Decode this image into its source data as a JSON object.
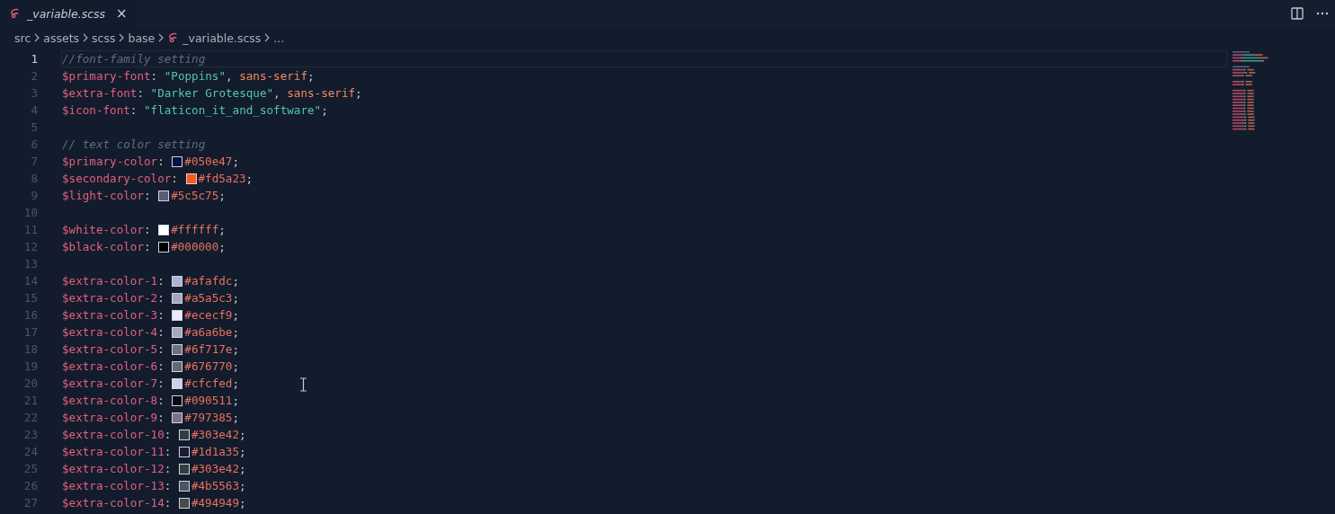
{
  "tab": {
    "label": "_variable.scss",
    "close": "×",
    "selected": true
  },
  "breadcrumb": [
    "src",
    "assets",
    "scss",
    "base",
    "_variable.scss",
    "..."
  ],
  "lines": [
    {
      "number": "1",
      "current": true,
      "tokens": [
        {
          "kind": "comment",
          "text": "//font-family setting"
        }
      ]
    },
    {
      "number": "2",
      "current": false,
      "tokens": [
        {
          "kind": "variable",
          "text": "$primary-font"
        },
        {
          "kind": "punct",
          "text": ": "
        },
        {
          "kind": "string",
          "text": "\"Poppins\""
        },
        {
          "kind": "punct",
          "text": ", "
        },
        {
          "kind": "value",
          "text": "sans-serif"
        },
        {
          "kind": "punct",
          "text": ";"
        }
      ]
    },
    {
      "number": "3",
      "current": false,
      "tokens": [
        {
          "kind": "variable",
          "text": "$extra-font"
        },
        {
          "kind": "punct",
          "text": ": "
        },
        {
          "kind": "string",
          "text": "\"Darker Grotesque\""
        },
        {
          "kind": "punct",
          "text": ", "
        },
        {
          "kind": "value",
          "text": "sans-serif"
        },
        {
          "kind": "punct",
          "text": ";"
        }
      ]
    },
    {
      "number": "4",
      "current": false,
      "tokens": [
        {
          "kind": "variable",
          "text": "$icon-font"
        },
        {
          "kind": "punct",
          "text": ": "
        },
        {
          "kind": "string",
          "text": "\"flaticon_it_and_software\""
        },
        {
          "kind": "punct",
          "text": ";"
        }
      ]
    },
    {
      "number": "5",
      "current": false
    },
    {
      "number": "6",
      "current": false,
      "tokens": [
        {
          "kind": "comment",
          "text": "// text color setting"
        }
      ]
    },
    {
      "number": "7",
      "current": false,
      "tokens": [
        {
          "kind": "variable",
          "text": "$primary-color"
        },
        {
          "kind": "punct",
          "text": ": "
        },
        {
          "kind": "swatch",
          "color": "#050e47"
        },
        {
          "kind": "value",
          "text": "#050e47"
        },
        {
          "kind": "punct",
          "text": ";"
        }
      ]
    },
    {
      "number": "8",
      "current": false,
      "tokens": [
        {
          "kind": "variable",
          "text": "$secondary-color"
        },
        {
          "kind": "punct",
          "text": ": "
        },
        {
          "kind": "swatch",
          "color": "#fd5a23"
        },
        {
          "kind": "value",
          "text": "#fd5a23"
        },
        {
          "kind": "punct",
          "text": ";"
        }
      ]
    },
    {
      "number": "9",
      "current": false,
      "tokens": [
        {
          "kind": "variable",
          "text": "$light-color"
        },
        {
          "kind": "punct",
          "text": ": "
        },
        {
          "kind": "swatch",
          "color": "#5c5c75"
        },
        {
          "kind": "value",
          "text": "#5c5c75"
        },
        {
          "kind": "punct",
          "text": ";"
        }
      ]
    },
    {
      "number": "10",
      "current": false
    },
    {
      "number": "11",
      "current": false,
      "tokens": [
        {
          "kind": "variable",
          "text": "$white-color"
        },
        {
          "kind": "punct",
          "text": ": "
        },
        {
          "kind": "swatch",
          "color": "#ffffff"
        },
        {
          "kind": "value",
          "text": "#ffffff"
        },
        {
          "kind": "punct",
          "text": ";"
        }
      ]
    },
    {
      "number": "12",
      "current": false,
      "tokens": [
        {
          "kind": "variable",
          "text": "$black-color"
        },
        {
          "kind": "punct",
          "text": ": "
        },
        {
          "kind": "swatch",
          "color": "#000000"
        },
        {
          "kind": "value",
          "text": "#000000"
        },
        {
          "kind": "punct",
          "text": ";"
        }
      ]
    },
    {
      "number": "13",
      "current": false
    },
    {
      "number": "14",
      "current": false,
      "tokens": [
        {
          "kind": "variable",
          "text": "$extra-color-1"
        },
        {
          "kind": "punct",
          "text": ": "
        },
        {
          "kind": "swatch",
          "color": "#afafdc"
        },
        {
          "kind": "value",
          "text": "#afafdc"
        },
        {
          "kind": "punct",
          "text": ";"
        }
      ]
    },
    {
      "number": "15",
      "current": false,
      "tokens": [
        {
          "kind": "variable",
          "text": "$extra-color-2"
        },
        {
          "kind": "punct",
          "text": ": "
        },
        {
          "kind": "swatch",
          "color": "#a5a5c3"
        },
        {
          "kind": "value",
          "text": "#a5a5c3"
        },
        {
          "kind": "punct",
          "text": ";"
        }
      ]
    },
    {
      "number": "16",
      "current": false,
      "tokens": [
        {
          "kind": "variable",
          "text": "$extra-color-3"
        },
        {
          "kind": "punct",
          "text": ": "
        },
        {
          "kind": "swatch",
          "color": "#ececf9"
        },
        {
          "kind": "value",
          "text": "#ececf9"
        },
        {
          "kind": "punct",
          "text": ";"
        }
      ]
    },
    {
      "number": "17",
      "current": false,
      "tokens": [
        {
          "kind": "variable",
          "text": "$extra-color-4"
        },
        {
          "kind": "punct",
          "text": ": "
        },
        {
          "kind": "swatch",
          "color": "#a6a6be"
        },
        {
          "kind": "value",
          "text": "#a6a6be"
        },
        {
          "kind": "punct",
          "text": ";"
        }
      ]
    },
    {
      "number": "18",
      "current": false,
      "tokens": [
        {
          "kind": "variable",
          "text": "$extra-color-5"
        },
        {
          "kind": "punct",
          "text": ": "
        },
        {
          "kind": "swatch",
          "color": "#6f717e"
        },
        {
          "kind": "value",
          "text": "#6f717e"
        },
        {
          "kind": "punct",
          "text": ";"
        }
      ]
    },
    {
      "number": "19",
      "current": false,
      "tokens": [
        {
          "kind": "variable",
          "text": "$extra-color-6"
        },
        {
          "kind": "punct",
          "text": ": "
        },
        {
          "kind": "swatch",
          "color": "#676770"
        },
        {
          "kind": "value",
          "text": "#676770"
        },
        {
          "kind": "punct",
          "text": ";"
        }
      ]
    },
    {
      "number": "20",
      "current": false,
      "tokens": [
        {
          "kind": "variable",
          "text": "$extra-color-7"
        },
        {
          "kind": "punct",
          "text": ": "
        },
        {
          "kind": "swatch",
          "color": "#cfcfed"
        },
        {
          "kind": "value",
          "text": "#cfcfed"
        },
        {
          "kind": "punct",
          "text": ";"
        }
      ]
    },
    {
      "number": "21",
      "current": false,
      "tokens": [
        {
          "kind": "variable",
          "text": "$extra-color-8"
        },
        {
          "kind": "punct",
          "text": ": "
        },
        {
          "kind": "swatch",
          "color": "#090511"
        },
        {
          "kind": "value",
          "text": "#090511"
        },
        {
          "kind": "punct",
          "text": ";"
        }
      ]
    },
    {
      "number": "22",
      "current": false,
      "tokens": [
        {
          "kind": "variable",
          "text": "$extra-color-9"
        },
        {
          "kind": "punct",
          "text": ": "
        },
        {
          "kind": "swatch",
          "color": "#797385"
        },
        {
          "kind": "value",
          "text": "#797385"
        },
        {
          "kind": "punct",
          "text": ";"
        }
      ]
    },
    {
      "number": "23",
      "current": false,
      "tokens": [
        {
          "kind": "variable",
          "text": "$extra-color-10"
        },
        {
          "kind": "punct",
          "text": ": "
        },
        {
          "kind": "swatch",
          "color": "#303e42"
        },
        {
          "kind": "value",
          "text": "#303e42"
        },
        {
          "kind": "punct",
          "text": ";"
        }
      ]
    },
    {
      "number": "24",
      "current": false,
      "tokens": [
        {
          "kind": "variable",
          "text": "$extra-color-11"
        },
        {
          "kind": "punct",
          "text": ": "
        },
        {
          "kind": "swatch",
          "color": "#1d1a35"
        },
        {
          "kind": "value",
          "text": "#1d1a35"
        },
        {
          "kind": "punct",
          "text": ";"
        }
      ]
    },
    {
      "number": "25",
      "current": false,
      "tokens": [
        {
          "kind": "variable",
          "text": "$extra-color-12"
        },
        {
          "kind": "punct",
          "text": ": "
        },
        {
          "kind": "swatch",
          "color": "#303e42"
        },
        {
          "kind": "value",
          "text": "#303e42"
        },
        {
          "kind": "punct",
          "text": ";"
        }
      ]
    },
    {
      "number": "26",
      "current": false,
      "tokens": [
        {
          "kind": "variable",
          "text": "$extra-color-13"
        },
        {
          "kind": "punct",
          "text": ": "
        },
        {
          "kind": "swatch",
          "color": "#4b5563"
        },
        {
          "kind": "value",
          "text": "#4b5563"
        },
        {
          "kind": "punct",
          "text": ";"
        }
      ]
    },
    {
      "number": "27",
      "current": false,
      "tokens": [
        {
          "kind": "variable",
          "text": "$extra-color-14"
        },
        {
          "kind": "punct",
          "text": ": "
        },
        {
          "kind": "swatch",
          "color": "#494949"
        },
        {
          "kind": "value",
          "text": "#494949"
        },
        {
          "kind": "punct",
          "text": ";"
        }
      ]
    }
  ]
}
